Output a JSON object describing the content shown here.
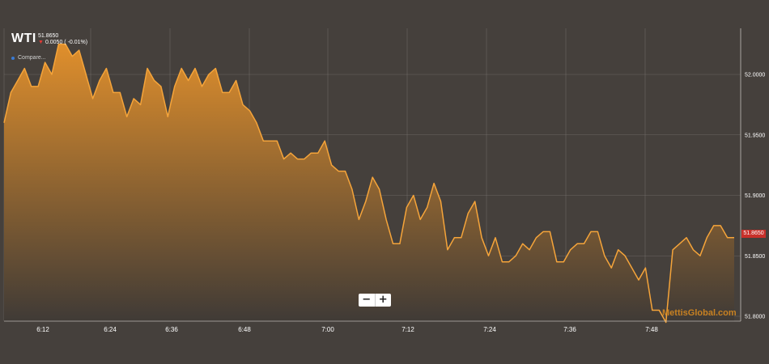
{
  "header": {
    "symbol": "WTI",
    "last_price": "51.8650",
    "change_arrow": "▼",
    "change": "0.0050 ( -0.01%)",
    "compare_label": "Compare..."
  },
  "zoom": {
    "minus": "−",
    "plus": "+"
  },
  "price_tag": "51.8650",
  "watermark": "MettisGlobal.com",
  "colors": {
    "background": "#45403c",
    "line": "#f5a43a",
    "fill_top": "#e08f2c",
    "fill_bottom": "#3f3a36",
    "grid": "#7a7572",
    "price_tag": "#c8302a",
    "watermark": "#e8921e"
  },
  "chart_data": {
    "type": "area",
    "title": "",
    "xlabel": "",
    "ylabel": "",
    "ylim": [
      51.795,
      52.04
    ],
    "x_ticks": [
      "6:12",
      "6:24",
      "6:36",
      "6:48",
      "7:00",
      "7:12",
      "7:24",
      "7:36",
      "7:48"
    ],
    "y_ticks": [
      "52.0000",
      "51.9500",
      "51.9000",
      "51.8500",
      "51.8000"
    ],
    "y_tick_values": [
      52.0,
      51.95,
      51.9,
      51.85,
      51.8
    ],
    "grid": true,
    "axis_position": "right",
    "series": [
      {
        "values": [
          51.96,
          51.985,
          51.995,
          52.005,
          51.99,
          51.99,
          52.01,
          52.0,
          52.025,
          52.025,
          52.015,
          52.02,
          52.0,
          51.98,
          51.995,
          52.005,
          51.985,
          51.985,
          51.965,
          51.98,
          51.975,
          52.005,
          51.995,
          51.99,
          51.965,
          51.99,
          52.005,
          51.995,
          52.005,
          51.99,
          52.0,
          52.005,
          51.985,
          51.985,
          51.995,
          51.975,
          51.97,
          51.96,
          51.945,
          51.945,
          51.945,
          51.93,
          51.935,
          51.93,
          51.93,
          51.935,
          51.935,
          51.945,
          51.925,
          51.92,
          51.92,
          51.905,
          51.88,
          51.895,
          51.915,
          51.905,
          51.88,
          51.86,
          51.86,
          51.89,
          51.9,
          51.88,
          51.89,
          51.91,
          51.895,
          51.855,
          51.865,
          51.865,
          51.885,
          51.895,
          51.865,
          51.85,
          51.865,
          51.845,
          51.845,
          51.85,
          51.86,
          51.855,
          51.865,
          51.87,
          51.87,
          51.845,
          51.845,
          51.855,
          51.86,
          51.86,
          51.87,
          51.87,
          51.85,
          51.84,
          51.855,
          51.85,
          51.84,
          51.83,
          51.84,
          51.805,
          51.805,
          51.795,
          51.855,
          51.86,
          51.865,
          51.855,
          51.85,
          51.865,
          51.875,
          51.875,
          51.865,
          51.865
        ]
      }
    ]
  }
}
